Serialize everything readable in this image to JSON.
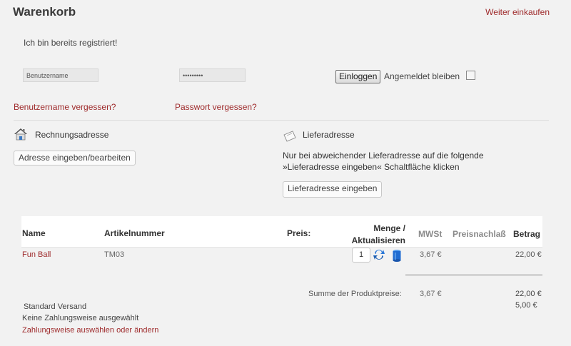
{
  "header": {
    "title": "Warenkorb",
    "continue_link": "Weiter einkaufen"
  },
  "login": {
    "registered_text": "Ich bin bereits registriert!",
    "username_placeholder": "Benutzername",
    "password_value": "•••••••••",
    "login_button": "Einloggen",
    "stay_logged_in": "Angemeldet bleiben",
    "stay_checked": false,
    "forgot_username": "Benutzername vergessen?",
    "forgot_password": "Passwort vergessen?"
  },
  "billing": {
    "label": "Rechnungsadresse",
    "button": "Adresse eingeben/bearbeiten"
  },
  "shipping": {
    "label": "Lieferadresse",
    "note": "Nur bei abweichender Lieferadresse auf die folgende »Lieferadresse eingeben« Schaltfläche klicken",
    "button": "Lieferadresse eingeben"
  },
  "table": {
    "headers": {
      "name": "Name",
      "article": "Artikelnummer",
      "price": "Preis:",
      "qty_line1": "Menge /",
      "qty_line2": "Aktualisieren",
      "tax": "MWSt",
      "discount": "Preisnachlaß",
      "amount": "Betrag"
    },
    "rows": [
      {
        "name": "Fun Ball",
        "article": "TM03",
        "qty": "1",
        "tax": "3,67 €",
        "amount": "22,00 €"
      }
    ]
  },
  "summary": {
    "label": "Summe der Produktpreise:",
    "tax": "3,67 €",
    "amount": "22,00 €",
    "shipping_method": "Standard Versand",
    "shipping_cost": "5,00 €",
    "no_payment": "Keine Zahlungsweise ausgewählt",
    "choose_payment": "Zahlungsweise auswählen oder ändern"
  },
  "colors": {
    "link_red": "#9e2a2b",
    "background": "#f2f2f2"
  },
  "icons": {
    "billing": "house-icon",
    "shipping": "card-icon",
    "update": "refresh-icon",
    "delete": "trash-icon"
  }
}
